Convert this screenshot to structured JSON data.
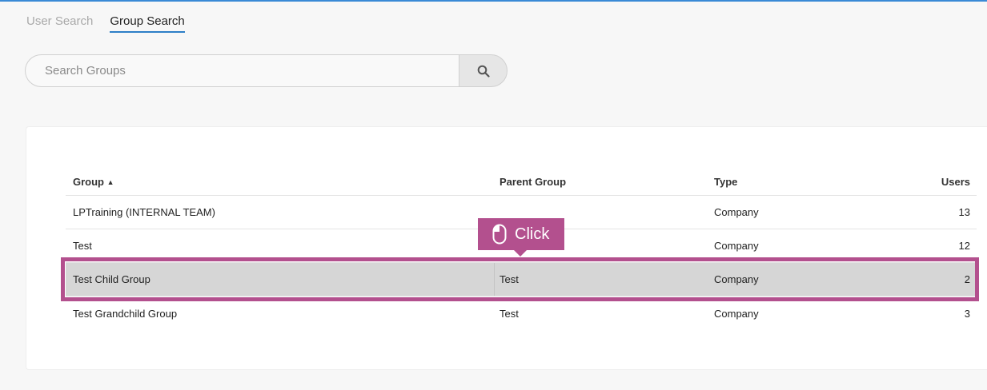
{
  "tabs": [
    {
      "label": "User Search",
      "active": false
    },
    {
      "label": "Group Search",
      "active": true
    }
  ],
  "search": {
    "placeholder": "Search Groups",
    "value": "",
    "button_icon": "search-icon"
  },
  "table": {
    "columns": {
      "group": "Group",
      "group_sort": "▲",
      "parent": "Parent Group",
      "type": "Type",
      "users": "Users"
    },
    "rows": [
      {
        "group": "LPTraining (INTERNAL TEAM)",
        "parent": "",
        "type": "Company",
        "users": "13"
      },
      {
        "group": "Test",
        "parent": "",
        "type": "Company",
        "users": "12"
      },
      {
        "group": "Test Child Group",
        "parent": "Test",
        "type": "Company",
        "users": "2"
      },
      {
        "group": "Test Grandchild Group",
        "parent": "Test",
        "type": "Company",
        "users": "3"
      }
    ]
  },
  "tooltip": {
    "label": "Click",
    "icon": "mouse-icon"
  },
  "colors": {
    "accent": "#2e7fc7",
    "highlight": "#b3508e",
    "selected_row": "#d6d6d6"
  }
}
